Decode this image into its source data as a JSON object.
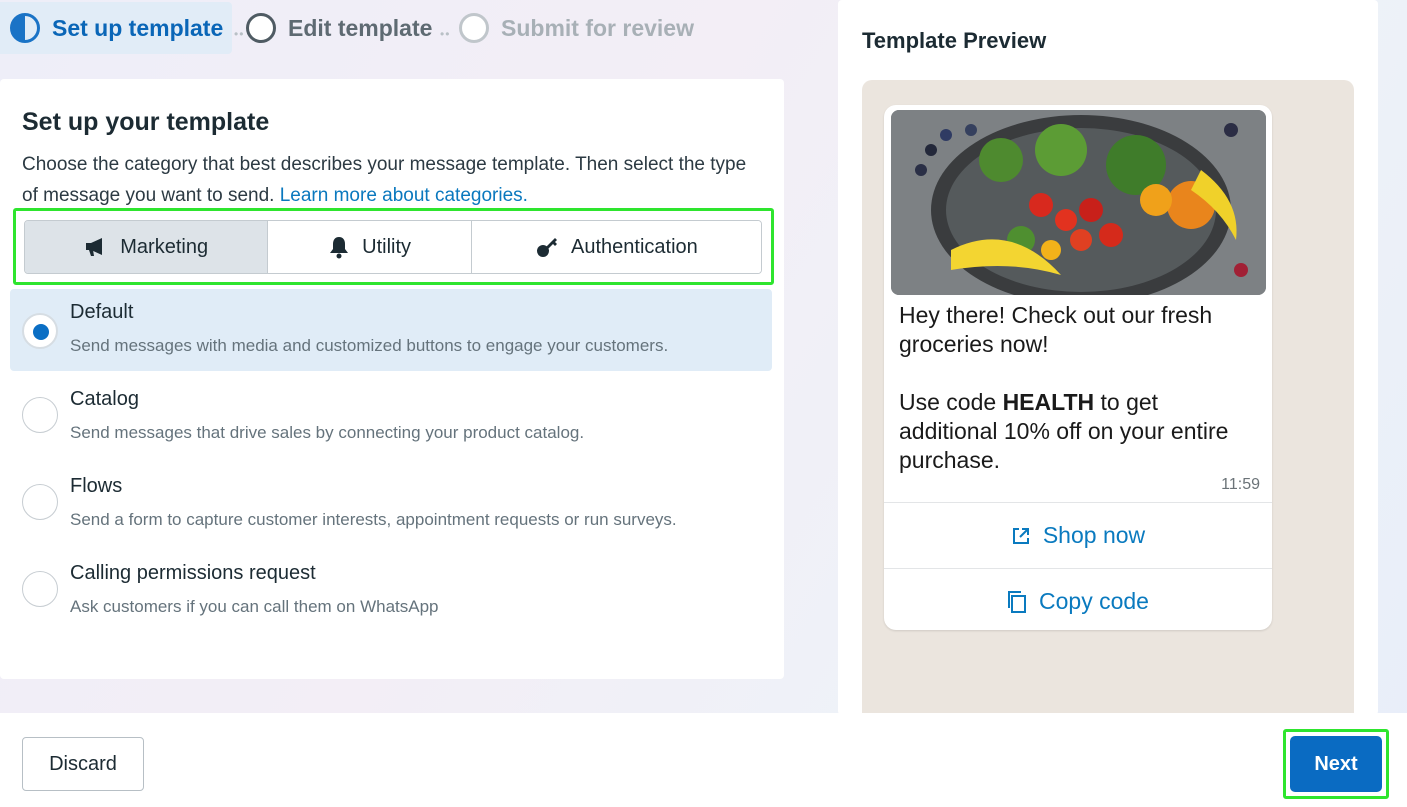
{
  "stepper": {
    "steps": [
      {
        "label": "Set up template",
        "state": "active"
      },
      {
        "label": "Edit template",
        "state": "next"
      },
      {
        "label": "Submit for review",
        "state": "disabled"
      }
    ]
  },
  "setup": {
    "title": "Set up your template",
    "description": "Choose the category that best describes your message template. Then select the type of message you want to send.",
    "learn_more": "Learn more about categories.",
    "categories": [
      {
        "label": "Marketing",
        "icon": "megaphone-icon",
        "selected": true
      },
      {
        "label": "Utility",
        "icon": "bell-icon",
        "selected": false
      },
      {
        "label": "Authentication",
        "icon": "key-icon",
        "selected": false
      }
    ],
    "options": [
      {
        "title": "Default",
        "subtitle": "Send messages with media and customized buttons to engage your customers.",
        "selected": true
      },
      {
        "title": "Catalog",
        "subtitle": "Send messages that drive sales by connecting your product catalog.",
        "selected": false
      },
      {
        "title": "Flows",
        "subtitle": "Send a form to capture customer interests, appointment requests or run surveys.",
        "selected": false
      },
      {
        "title": "Calling permissions request",
        "subtitle": "Ask customers if you can call them on WhatsApp",
        "selected": false
      }
    ]
  },
  "preview": {
    "title": "Template Preview",
    "message_line1": "Hey there! Check out our fresh groceries now!",
    "message_pre": "Use code ",
    "message_code": "HEALTH",
    "message_post": " to get additional 10% off on your entire purchase.",
    "time": "11:59",
    "buttons": [
      {
        "label": "Shop now",
        "icon": "external-link-icon"
      },
      {
        "label": "Copy code",
        "icon": "copy-icon"
      }
    ]
  },
  "footer": {
    "discard_label": "Discard",
    "next_label": "Next"
  },
  "colors": {
    "accent": "#0a6bc2",
    "link": "#0a78be",
    "highlight": "#2ee52e"
  }
}
